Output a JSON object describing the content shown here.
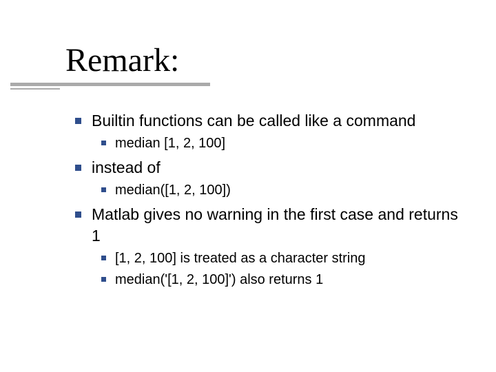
{
  "title": "Remark:",
  "bullets": [
    {
      "text": "Builtin functions can be called like a command",
      "children": [
        {
          "text": "median [1, 2, 100]"
        }
      ]
    },
    {
      "text": "instead of",
      "children": [
        {
          "text": "median([1, 2, 100])"
        }
      ]
    },
    {
      "text": "Matlab gives no warning in the first case and returns  1",
      "children": [
        {
          "text": "[1, 2, 100] is treated as a character string"
        },
        {
          "text": "median('[1, 2, 100]')  also returns 1"
        }
      ]
    }
  ]
}
